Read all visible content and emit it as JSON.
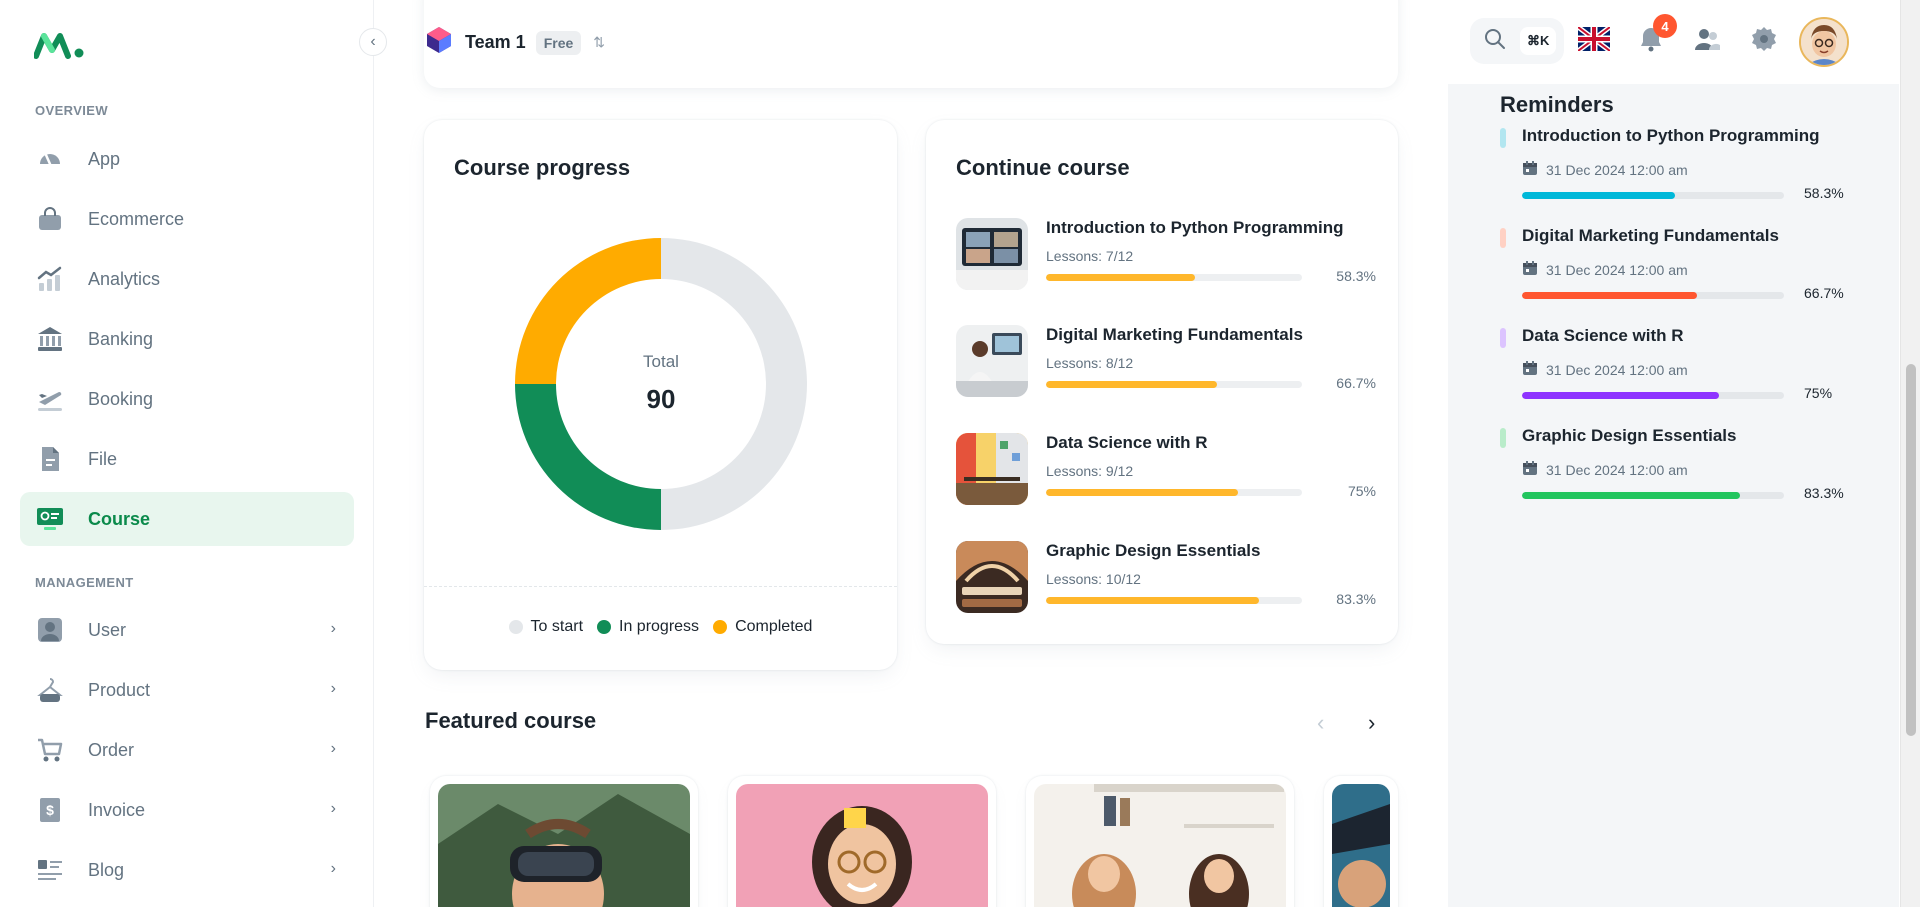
{
  "sidebar": {
    "overview_label": "OVERVIEW",
    "management_label": "MANAGEMENT",
    "overview_items": [
      {
        "label": "App",
        "icon": "dashboard-gauge-icon"
      },
      {
        "label": "Ecommerce",
        "icon": "shopping-bag-icon"
      },
      {
        "label": "Analytics",
        "icon": "analytics-chart-icon"
      },
      {
        "label": "Banking",
        "icon": "bank-icon"
      },
      {
        "label": "Booking",
        "icon": "airplane-icon"
      },
      {
        "label": "File",
        "icon": "file-icon"
      },
      {
        "label": "Course",
        "icon": "course-screen-icon"
      }
    ],
    "management_items": [
      {
        "label": "User",
        "icon": "user-icon"
      },
      {
        "label": "Product",
        "icon": "product-bag-icon"
      },
      {
        "label": "Order",
        "icon": "cart-icon"
      },
      {
        "label": "Invoice",
        "icon": "invoice-icon"
      },
      {
        "label": "Blog",
        "icon": "blog-icon"
      }
    ],
    "active_color": "#0b8a4b"
  },
  "header": {
    "team_name": "Team 1",
    "plan": "Free",
    "search_shortcut": "⌘K",
    "notification_count": "4"
  },
  "course_progress": {
    "title": "Course progress",
    "total_label": "Total",
    "total_value": "90",
    "legend": [
      "To start",
      "In progress",
      "Completed"
    ]
  },
  "chart_data": {
    "type": "pie",
    "variant": "donut",
    "categories": [
      "To start",
      "In progress",
      "Completed"
    ],
    "values": [
      45,
      22.5,
      22.5
    ],
    "colors": [
      "#e4e7ea",
      "#118d57",
      "#ffab00"
    ],
    "title": "Course progress",
    "center_label": "Total",
    "center_value": 90,
    "legend_position": "bottom"
  },
  "continue_course": {
    "title": "Continue course",
    "items": [
      {
        "title": "Introduction to Python Programming",
        "lessons": "Lessons: 7/12",
        "progress": 58.3,
        "pct": "58.3%"
      },
      {
        "title": "Digital Marketing Fundamentals",
        "lessons": "Lessons: 8/12",
        "progress": 66.7,
        "pct": "66.7%"
      },
      {
        "title": "Data Science with R",
        "lessons": "Lessons: 9/12",
        "progress": 75,
        "pct": "75%"
      },
      {
        "title": "Graphic Design Essentials",
        "lessons": "Lessons: 10/12",
        "progress": 83.3,
        "pct": "83.3%"
      }
    ]
  },
  "featured": {
    "title": "Featured course"
  },
  "reminders": {
    "title": "Reminders",
    "items": [
      {
        "title": "Introduction to Python Programming",
        "date": "31 Dec 2024 12:00 am",
        "progress": 58.3,
        "pct": "58.3%",
        "color": "#00b8d9",
        "mark": "#b2e6f0"
      },
      {
        "title": "Digital Marketing Fundamentals",
        "date": "31 Dec 2024 12:00 am",
        "progress": 66.7,
        "pct": "66.7%",
        "color": "#ff5630",
        "mark": "#ffd1c4"
      },
      {
        "title": "Data Science with R",
        "date": "31 Dec 2024 12:00 am",
        "progress": 75,
        "pct": "75%",
        "color": "#8e33ff",
        "mark": "#dcc4ff"
      },
      {
        "title": "Graphic Design Essentials",
        "date": "31 Dec 2024 12:00 am",
        "progress": 83.3,
        "pct": "83.3%",
        "color": "#22c55e",
        "mark": "#b9ecca"
      }
    ]
  }
}
